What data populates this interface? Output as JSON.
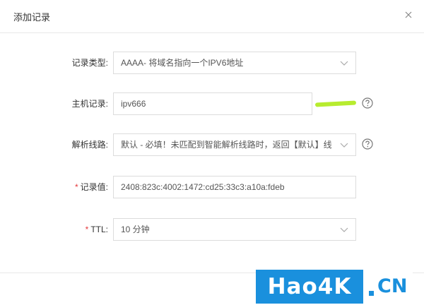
{
  "dialog": {
    "title": "添加记录",
    "close_icon": "close-icon"
  },
  "form": {
    "record_type": {
      "label": "记录类型:",
      "value": "AAAA- 将域名指向一个IPV6地址",
      "required": false
    },
    "host": {
      "label": "主机记录:",
      "value": "ipv666",
      "help_icon": "question-circle-icon",
      "required": false
    },
    "line": {
      "label": "解析线路:",
      "value": "默认 - 必填！未匹配到智能解析线路时，返回【默认】线路...",
      "help_icon": "question-circle-icon",
      "required": false
    },
    "record_value": {
      "label": "记录值:",
      "required_mark": "*",
      "value": "2408:823c:4002:1472:cd25:33c3:a10a:fdeb",
      "required": true
    },
    "ttl": {
      "label": "TTL:",
      "required_mark": "*",
      "value": "10 分钟",
      "required": true
    }
  },
  "watermark": {
    "left": "Hao4K",
    "right": "CN"
  },
  "colors": {
    "required": "#e4393c",
    "highlight": "#b7ec2f",
    "watermark": "#1a90dd",
    "border": "#dcdcdc"
  }
}
